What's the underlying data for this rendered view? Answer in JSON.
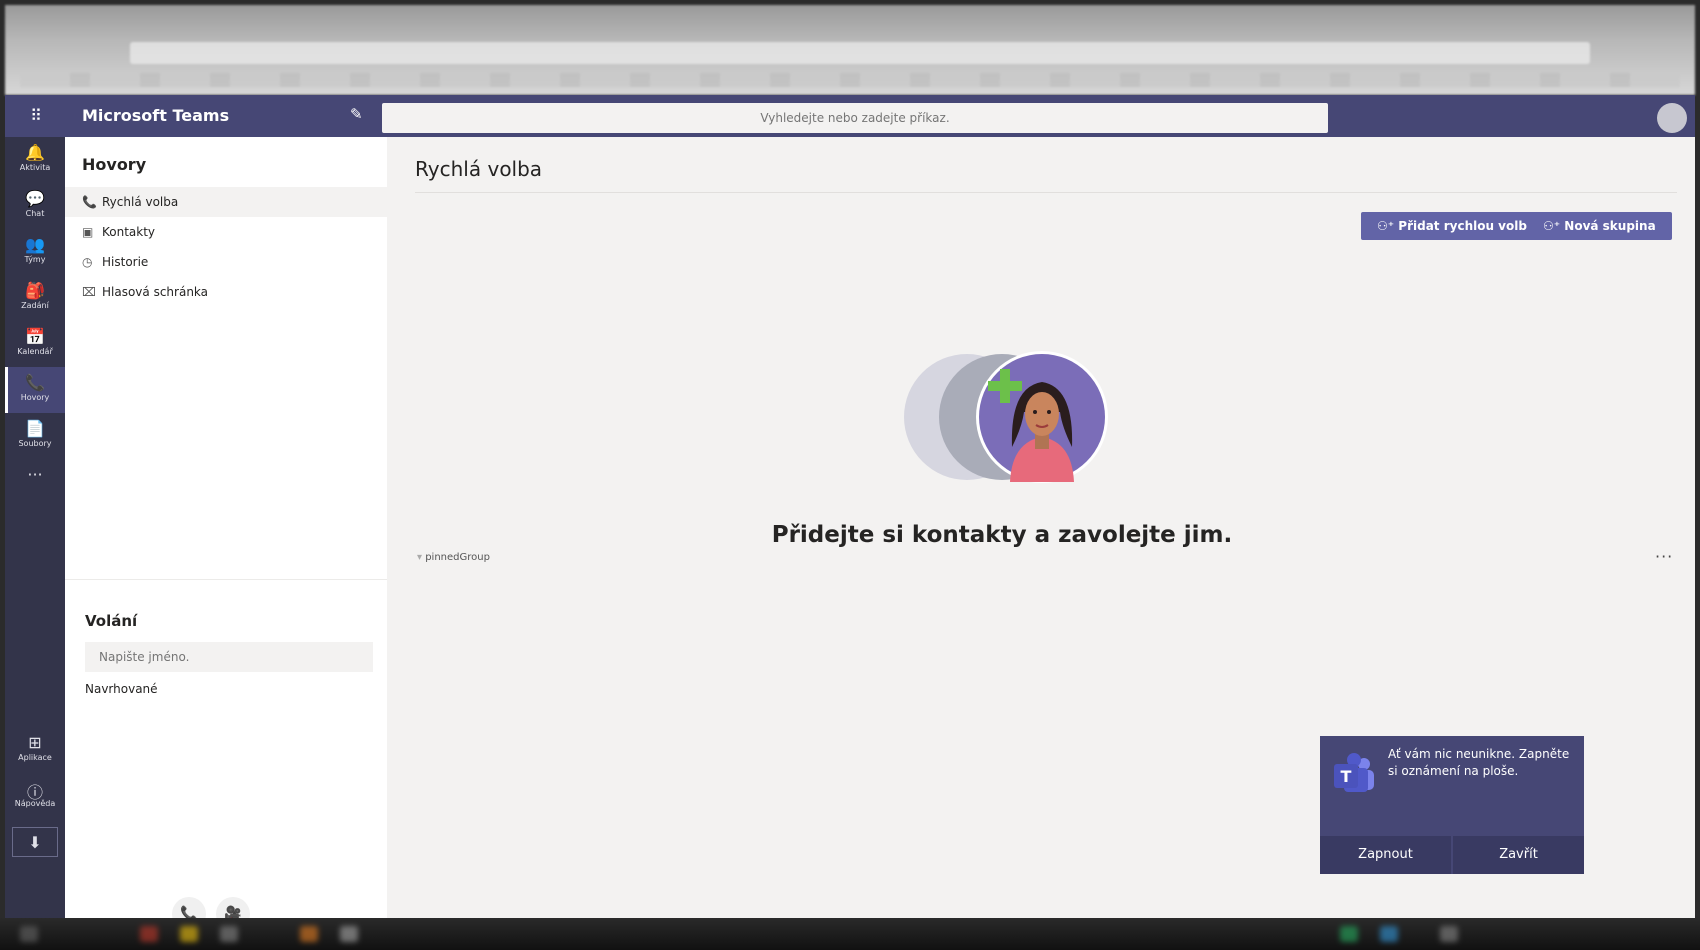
{
  "app": {
    "name": "Microsoft Teams"
  },
  "search": {
    "placeholder": "Vyhledejte nebo zadejte příkaz."
  },
  "rail": {
    "items": [
      {
        "label": "Aktivita",
        "icon": "bell-icon"
      },
      {
        "label": "Chat",
        "icon": "chat-icon"
      },
      {
        "label": "Týmy",
        "icon": "teams-icon"
      },
      {
        "label": "Zadání",
        "icon": "assignments-icon"
      },
      {
        "label": "Kalendář",
        "icon": "calendar-icon"
      },
      {
        "label": "Hovory",
        "icon": "phone-icon",
        "active": true
      },
      {
        "label": "Soubory",
        "icon": "files-icon"
      }
    ],
    "bottom": [
      {
        "label": "Aplikace",
        "icon": "apps-icon"
      },
      {
        "label": "Nápověda",
        "icon": "help-icon"
      }
    ]
  },
  "left_panel": {
    "title": "Hovory",
    "nav": [
      {
        "label": "Rychlá volba",
        "icon": "phone-icon",
        "selected": true
      },
      {
        "label": "Kontakty",
        "icon": "contacts-icon"
      },
      {
        "label": "Historie",
        "icon": "history-icon"
      },
      {
        "label": "Hlasová schránka",
        "icon": "voicemail-icon"
      }
    ],
    "call_section": {
      "title": "Volání",
      "input_placeholder": "Napište jméno.",
      "suggested_label": "Navrhované"
    }
  },
  "main": {
    "title": "Rychlá volba",
    "add_speed_dial_label": "Přidat rychlou volbu",
    "new_group_label": "Nová skupina",
    "empty_text": "Přidejte si kontakty a zavolejte jim.",
    "pinned_group": "pinnedGroup",
    "more_label": "···"
  },
  "toast": {
    "text": "Ať vám nic neunikne. Zapněte si oznámení na ploše.",
    "enable_label": "Zapnout",
    "close_label": "Zavřít"
  },
  "colors": {
    "brand": "#464775",
    "accent": "#6264a7",
    "rail": "#33344a"
  }
}
